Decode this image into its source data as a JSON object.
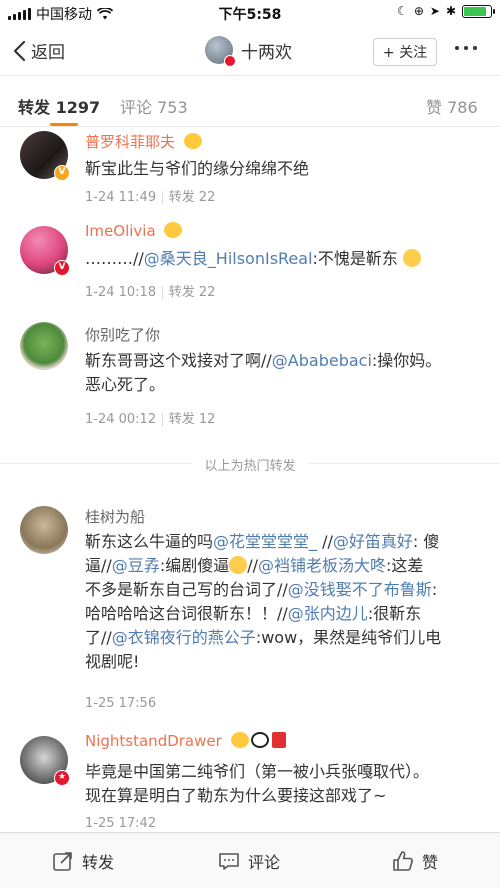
{
  "status_bar": {
    "carrier": "中国移动",
    "time": "下午5:58",
    "battery_level": 0.85
  },
  "nav": {
    "back_label": "返回",
    "title": "十两欢",
    "follow_label": "+ 关注"
  },
  "tabs": {
    "repost": "转发 1297",
    "comment": "评论 753",
    "like": "赞 786"
  },
  "comments": [
    {
      "username": "普罗科菲耶夫",
      "text": "靳宝此生与爷们的缘分绵绵不绝",
      "time": "1-24 11:49",
      "repost_count": "转发 22"
    },
    {
      "username": "ImeOlivia",
      "text_prefix": "………//",
      "mention": "@桑天良_HilsonIsReal",
      "text_suffix": ":不愧是靳东",
      "time": "1-24 10:18",
      "repost_count": "转发 22"
    },
    {
      "username": "你别吃了你",
      "text_line1_prefix": "靳东哥哥这个戏接对了啊//",
      "mention": "@Ababebaci",
      "text_line1_suffix": ":操你妈。",
      "text_line2": "恶心死了。",
      "time": "1-24 00:12",
      "repost_count": "转发 12"
    },
    {
      "username": "桂树为船",
      "l1a": "靳东这么牛逼的吗",
      "m1": "@花堂堂堂堂_",
      "l1b": " //",
      "m2": "@好笛真好",
      "l1c": ": 傻",
      "l2a": "逼//",
      "m3": "@豆孨",
      "l2b": ":编剧傻逼",
      "l2c": "//",
      "m4": "@裆铺老板汤大咚",
      "l2d": ":这差",
      "l3a": "不多是靳东自己写的台词了//",
      "m5": "@没钱娶不了布鲁斯",
      "l3b": ":",
      "l4a": "哈哈哈哈这台词很靳东！！//",
      "m6": "@张内边儿",
      "l4b": ":很靳东",
      "l5a": "了//",
      "m7": "@衣锦夜行的燕公子",
      "l5b": ":wow，果然是纯爷们儿电",
      "l6": "视剧呢!",
      "time": "1-25 17:56"
    },
    {
      "username": "NightstandDrawer",
      "line1": "毕竟是中国第二纯爷们（第一被小兵张嘎取代）。",
      "line2": "现在算是明白了勒东为什么要接这部戏了~",
      "time": "1-25 17:42"
    }
  ],
  "hot_divider_label": "以上为热门转发",
  "bottom_bar": {
    "repost": "转发",
    "comment": "评论",
    "like": "赞"
  },
  "colors": {
    "accent_orange": "#ff8200",
    "username_orange": "#eb7350",
    "mention_blue": "#507daf"
  },
  "icons": [
    "back-chevron-icon",
    "wifi-icon",
    "battery-icon",
    "more-dots-icon",
    "repost-icon",
    "comment-icon",
    "like-icon"
  ]
}
